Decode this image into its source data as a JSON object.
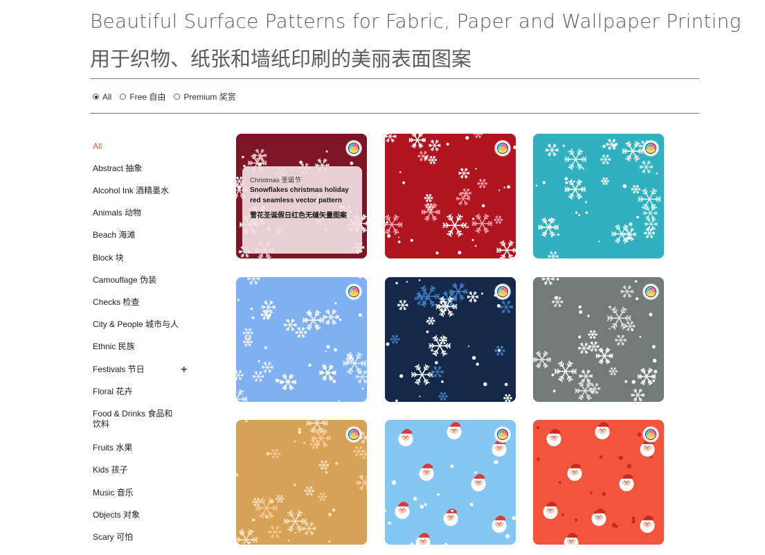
{
  "header": {
    "title_en": "Beautiful Surface Patterns for Fabric, Paper and Wallpaper Printing",
    "title_zh": "用于织物、纸张和墙纸印刷的美丽表面图案"
  },
  "filters": {
    "options": [
      {
        "label": "All",
        "checked": true
      },
      {
        "label": "Free 自由",
        "checked": false
      },
      {
        "label": "Premium 奖赏",
        "checked": false
      }
    ]
  },
  "sidebar": {
    "items": [
      {
        "label": "All"
      },
      {
        "label": "Abstract 抽象"
      },
      {
        "label": "Alcohol Ink 酒精墨水"
      },
      {
        "label": "Animals 动物"
      },
      {
        "label": "Beach 海滩"
      },
      {
        "label": "Block 块"
      },
      {
        "label": "Camouflage 伪装"
      },
      {
        "label": "Checks 检查"
      },
      {
        "label": "City & People 城市与人"
      },
      {
        "label": "Ethnic 民族"
      },
      {
        "label": "Festivals 节日"
      },
      {
        "label": "Floral 花卉"
      },
      {
        "label": "Food & Drinks 食品和饮料"
      },
      {
        "label": "Fruits 水果"
      },
      {
        "label": "Kids 孩子"
      },
      {
        "label": "Music 音乐"
      },
      {
        "label": "Objects 对象"
      },
      {
        "label": "Scary 可怕"
      }
    ],
    "active_color": "#e05a3a"
  },
  "hover_card": {
    "category": "Christmas 圣诞节",
    "title_en": "Snowflakes christmas holiday red seamless vector pattern",
    "title_zh": "雪花圣诞假日红色无缝矢量图案"
  },
  "tiles": [
    {
      "motif": "snowflake",
      "bg": "#7c1626",
      "fg": "#ffffff",
      "fg2": "#f3c9cf"
    },
    {
      "motif": "snowflake",
      "bg": "#b0141f",
      "fg": "#ffffff",
      "fg2": "#f7a3ad"
    },
    {
      "motif": "snowflake",
      "bg": "#31b1bf",
      "fg": "#ffffff",
      "fg2": "#d9f4f7"
    },
    {
      "motif": "snowflake",
      "bg": "#7fb0f2",
      "fg": "#ffffff",
      "fg2": "#e6f0ff"
    },
    {
      "motif": "snowflake",
      "bg": "#14294a",
      "fg": "#ffffff",
      "fg2": "#3f7ec0"
    },
    {
      "motif": "snowflake",
      "bg": "#717b77",
      "fg": "#ffffff",
      "fg2": "#dfe4e2"
    },
    {
      "motif": "snowflake",
      "bg": "#d5a257",
      "fg": "#fbe2c2",
      "fg2": "#f6c893"
    },
    {
      "motif": "santa",
      "bg": "#86c6f2",
      "fg": "#ffffff",
      "fg2": "#d93a3a"
    },
    {
      "motif": "santa",
      "bg": "#f2553c",
      "fg": "#ffffff",
      "fg2": "#c92b22"
    }
  ],
  "badge_icon": "premium-color-circles-icon"
}
